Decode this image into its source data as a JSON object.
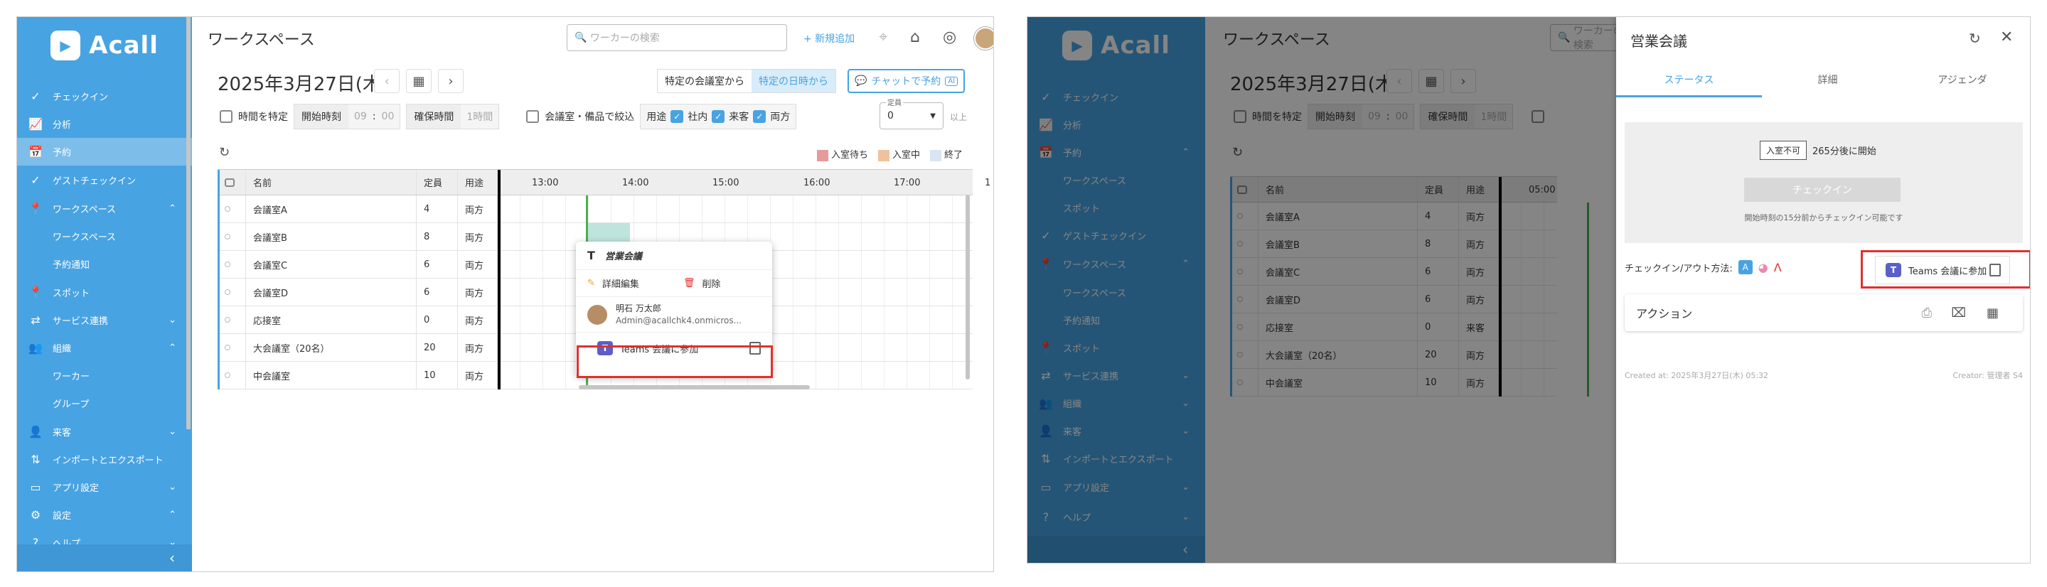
{
  "brand": "Acall",
  "sidebar_a": [
    {
      "id": "checkin",
      "label": "チェックイン",
      "icon": "✓"
    },
    {
      "id": "analytics",
      "label": "分析",
      "icon": "📈"
    },
    {
      "id": "reservation",
      "label": "予約",
      "icon": "📅"
    },
    {
      "id": "guest-checkin",
      "label": "ゲストチェックイン",
      "icon": "✓"
    },
    {
      "id": "workspace",
      "label": "ワークスペース",
      "icon": "📍",
      "chev": "^"
    },
    {
      "id": "workspace-sub",
      "label": "ワークスペース",
      "sub": true
    },
    {
      "id": "reservation-notice",
      "label": "予約通知",
      "sub": true
    },
    {
      "id": "spot",
      "label": "スポット",
      "icon": "📍"
    },
    {
      "id": "service",
      "label": "サービス連携",
      "icon": "⇄",
      "chev": "v"
    },
    {
      "id": "org",
      "label": "組織",
      "icon": "👥",
      "chev": "^"
    },
    {
      "id": "worker",
      "label": "ワーカー",
      "sub": true
    },
    {
      "id": "group",
      "label": "グループ",
      "sub": true
    },
    {
      "id": "visitor",
      "label": "来客",
      "icon": "👤",
      "chev": "v"
    },
    {
      "id": "import-export",
      "label": "インポートとエクスポート",
      "icon": "⇅"
    },
    {
      "id": "app-settings",
      "label": "アプリ設定",
      "icon": "▭",
      "chev": "v"
    },
    {
      "id": "settings",
      "label": "設定",
      "icon": "⚙",
      "chev": "^"
    },
    {
      "id": "help",
      "label": "ヘルプ",
      "icon": "?",
      "chev": "v"
    }
  ],
  "sidebar_b": [
    {
      "id": "checkin",
      "label": "チェックイン",
      "icon": "✓"
    },
    {
      "id": "analytics",
      "label": "分析",
      "icon": "📈"
    },
    {
      "id": "reservation",
      "label": "予約",
      "icon": "📅",
      "chev": "^"
    },
    {
      "id": "workspace-sub",
      "label": "ワークスペース",
      "sub": true
    },
    {
      "id": "spot-sub",
      "label": "スポット",
      "sub": true
    },
    {
      "id": "guest-checkin",
      "label": "ゲストチェックイン",
      "icon": "✓"
    },
    {
      "id": "workspace",
      "label": "ワークスペース",
      "icon": "📍",
      "chev": "^"
    },
    {
      "id": "workspace-sub2",
      "label": "ワークスペース",
      "sub": true
    },
    {
      "id": "reservation-notice",
      "label": "予約通知",
      "sub": true
    },
    {
      "id": "spot",
      "label": "スポット",
      "icon": "📍"
    },
    {
      "id": "service",
      "label": "サービス連携",
      "icon": "⇄",
      "chev": "v"
    },
    {
      "id": "org",
      "label": "組織",
      "icon": "👥",
      "chev": "v"
    },
    {
      "id": "visitor",
      "label": "来客",
      "icon": "👤",
      "chev": "v"
    },
    {
      "id": "import-export",
      "label": "インポートとエクスポート",
      "icon": "⇅"
    },
    {
      "id": "app-settings",
      "label": "アプリ設定",
      "icon": "▭",
      "chev": "v"
    },
    {
      "id": "help",
      "label": "ヘルプ",
      "icon": "?",
      "chev": "v"
    }
  ],
  "header": {
    "title": "ワークスペース",
    "search_placeholder": "ワーカーの検索",
    "add_new": "+ 新規追加"
  },
  "date": "2025年3月27日(木)",
  "filters": {
    "specific_room": "特定の会議室から",
    "specific_time": "特定の日時から",
    "chat_reserve": "チャットで予約",
    "ai": "AI",
    "time_label": "時間を特定",
    "start_label": "開始時刻",
    "start_h": "09",
    "start_m": "00",
    "sep": ":",
    "duration_label": "確保時間",
    "duration_val": "1時間",
    "narrow_label": "会議室・備品で絞込",
    "usage_label": "用途",
    "usage_internal": "社内",
    "usage_visitor": "来客",
    "usage_both": "両方",
    "capacity_caption": "定員",
    "capacity_val": "0",
    "capacity_suffix": "以上"
  },
  "legend": [
    {
      "label": "入室待ち",
      "color": "#e79a9a"
    },
    {
      "label": "入室中",
      "color": "#f0c29c"
    },
    {
      "label": "終了",
      "color": "#d7e6f2"
    }
  ],
  "grid_head": {
    "name": "名前",
    "cap": "定員",
    "use": "用途"
  },
  "times_a": [
    "13:00",
    "14:00",
    "15:00",
    "16:00",
    "17:00",
    "1"
  ],
  "times_b": [
    "05:00"
  ],
  "rooms": [
    {
      "name": "会議室A",
      "cap": "4",
      "use": "両方"
    },
    {
      "name": "会議室B",
      "cap": "8",
      "use": "両方"
    },
    {
      "name": "会議室C",
      "cap": "6",
      "use": "両方"
    },
    {
      "name": "会議室D",
      "cap": "6",
      "use": "両方"
    },
    {
      "name": "応接室",
      "cap": "0",
      "use": "両方"
    },
    {
      "name": "大会議室（20名）",
      "cap": "20",
      "use": "両方"
    },
    {
      "name": "中会議室",
      "cap": "10",
      "use": "両方"
    }
  ],
  "rooms_b_use": [
    "両方",
    "両方",
    "両方",
    "両方",
    "来客",
    "両方",
    "両方"
  ],
  "popup": {
    "title": "営業会議",
    "edit": "詳細編集",
    "delete": "削除",
    "user_name": "明石 万太郎",
    "user_email": "Admin@acallchk4.onmicros...",
    "teams": "Teams 会議に参加"
  },
  "panel": {
    "title": "営業会議",
    "tabs": [
      "ステータス",
      "詳細",
      "アジェンダ"
    ],
    "status_badge": "入室不可",
    "status_text": "265分後に開始",
    "checkin_btn": "チェックイン",
    "checkin_note": "開始時刻の15分前からチェックイン可能です",
    "method_label": "チェックイン/アウト方法:",
    "teams": "Teams 会議に参加",
    "action": "アクション",
    "created": "Created at: 2025年3月27日(木) 05:32",
    "creator": "Creator: 管理者 S4"
  },
  "colors": {
    "sidebar": "#48a3e2",
    "accent": "#48a3e2",
    "highlight": "#e0302e",
    "teams": "#5b5fc7"
  }
}
